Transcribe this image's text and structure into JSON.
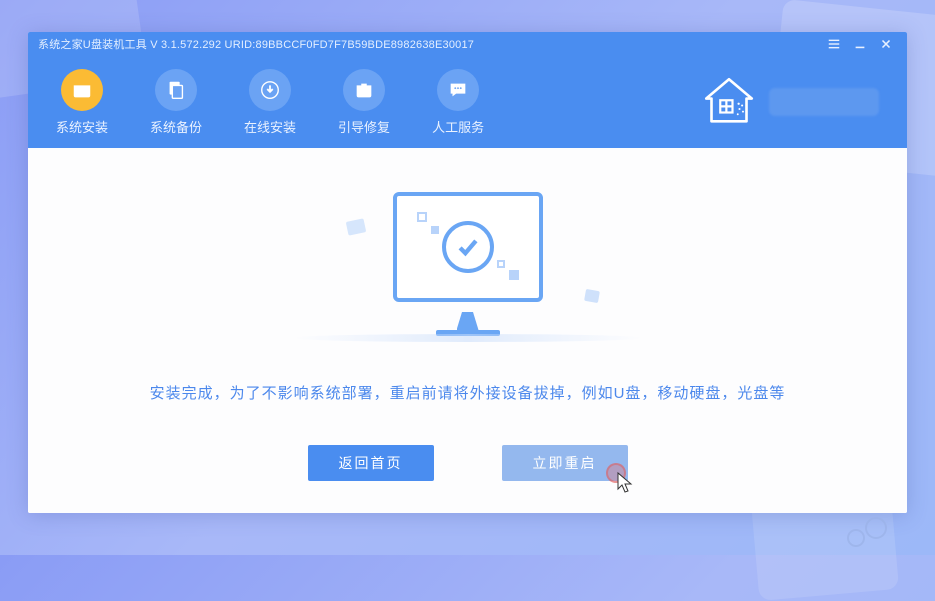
{
  "titlebar": {
    "text": "系统之家U盘装机工具 V 3.1.572.292 URID:89BBCCF0FD7F7B59BDE8982638E30017"
  },
  "tabs": [
    {
      "label": "系统安装",
      "icon": "box-icon",
      "active": true
    },
    {
      "label": "系统备份",
      "icon": "copy-icon",
      "active": false
    },
    {
      "label": "在线安装",
      "icon": "download-icon",
      "active": false
    },
    {
      "label": "引导修复",
      "icon": "briefcase-icon",
      "active": false
    },
    {
      "label": "人工服务",
      "icon": "chat-icon",
      "active": false
    }
  ],
  "content": {
    "message": "安装完成，为了不影响系统部署，重启前请将外接设备拔掉，例如U盘，移动硬盘，光盘等"
  },
  "buttons": {
    "back_home": "返回首页",
    "restart_now": "立即重启"
  },
  "colors": {
    "accent": "#4a8df0",
    "accent_light": "#6aa6f4",
    "highlight": "#fbbb34"
  }
}
